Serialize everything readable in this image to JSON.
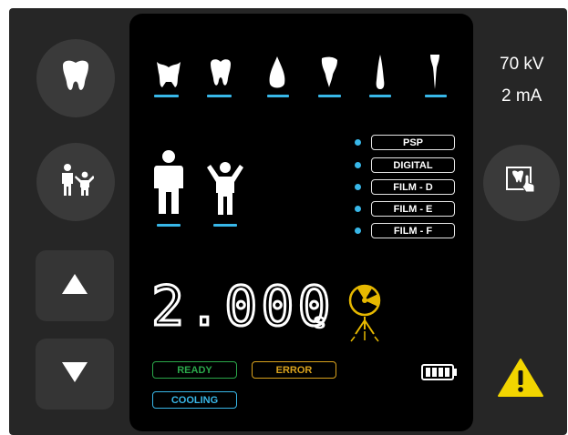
{
  "kv": "70 kV",
  "ma": "2 mA",
  "exposure": {
    "time_digits": "2.000",
    "unit": "s"
  },
  "teeth_selection": [
    "molar",
    "premolar",
    "canine",
    "upper-incisor",
    "lower-incisor",
    "root-incisor"
  ],
  "patient_types": [
    "adult",
    "child"
  ],
  "image_modes": [
    "PSP",
    "DIGITAL",
    "FILM - D",
    "FILM - E",
    "FILM - F"
  ],
  "status": {
    "ready": "READY",
    "error": "ERROR",
    "cooling": "COOLING"
  },
  "colors": {
    "accent": "#38b7e8",
    "ready": "#2aa84a",
    "error": "#d9a21d",
    "cooling": "#38b7e8",
    "radiation": "#e6b800",
    "warning": "#f2d500"
  },
  "icons": [
    "tooth-icon",
    "adult-child-icon",
    "arrow-up-icon",
    "arrow-down-icon",
    "tooth-touch-icon",
    "radiation-icon",
    "battery-icon",
    "warning-icon"
  ]
}
